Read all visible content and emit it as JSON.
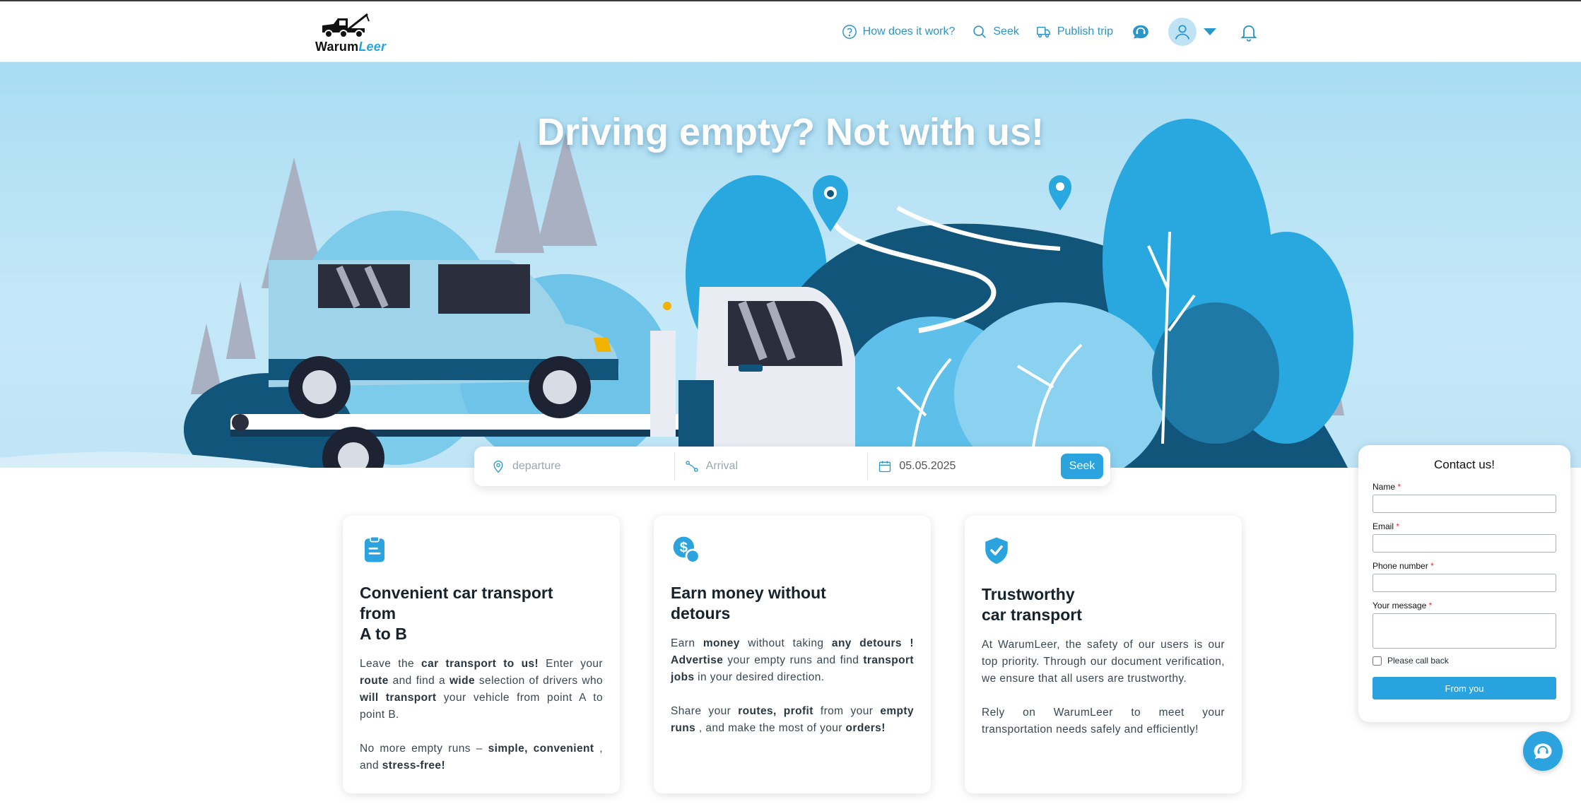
{
  "header": {
    "logo_text_main": "Warum",
    "logo_text_accent": "Leer",
    "nav": {
      "how_label": "How does it work?",
      "seek_label": "Seek",
      "publish_label": "Publish trip"
    }
  },
  "hero": {
    "title": "Driving empty? Not with us!"
  },
  "search": {
    "departure_placeholder": "departure",
    "arrival_placeholder": "Arrival",
    "date_value": "05.05.2025",
    "seek_label": "Seek"
  },
  "cards": [
    {
      "icon": "clipboard-icon",
      "title": "Convenient car transport\nfrom\nA to B"
    },
    {
      "icon": "money-icon",
      "title": "Earn money without\ndetours"
    },
    {
      "icon": "shield-check-icon",
      "title": "Trustworthy\ncar transport"
    }
  ],
  "card_texts": {
    "c1_p1_a": "Leave the ",
    "c1_p1_b": "car transport to us!",
    "c1_p1_c": " Enter your ",
    "c1_p1_d": "route",
    "c1_p1_e": " and find a ",
    "c1_p1_f": "wide",
    "c1_p1_g": " selection of drivers who ",
    "c1_p1_h": "will transport",
    "c1_p1_i": " your vehicle from point A to point B.",
    "c1_p2_a": "No more empty runs – ",
    "c1_p2_b": "simple, convenient",
    "c1_p2_c": " , and ",
    "c1_p2_d": "stress-free!",
    "c2_p1_a": "Earn ",
    "c2_p1_b": "money",
    "c2_p1_c": " without taking ",
    "c2_p1_d": "any detours !",
    "c2_p1_e": " ",
    "c2_p1_f": "Advertise",
    "c2_p1_g": " your empty runs and find ",
    "c2_p1_h": "transport jobs",
    "c2_p1_i": " in your desired direction.",
    "c2_p2_a": "Share your ",
    "c2_p2_b": "routes, profit",
    "c2_p2_c": " from your ",
    "c2_p2_d": "empty runs",
    "c2_p2_e": " , and make the most of your ",
    "c2_p2_f": "orders!",
    "c3_p1": "At WarumLeer, the safety of our users is our top priority. Through our document verification, we ensure that all users are trustworthy.",
    "c3_p2": "Rely on WarumLeer to meet your transportation needs safely and efficiently!"
  },
  "contact": {
    "title": "Contact us!",
    "name_label": "Name",
    "email_label": "Email",
    "phone_label": "Phone number",
    "message_label": "Your message",
    "required_mark": "*",
    "callback_label": "Please call back",
    "submit_label": "From you"
  },
  "colors": {
    "accent": "#2aa3df",
    "nav_text": "#2a95c9",
    "hero_sky": "#a9dcf2"
  }
}
